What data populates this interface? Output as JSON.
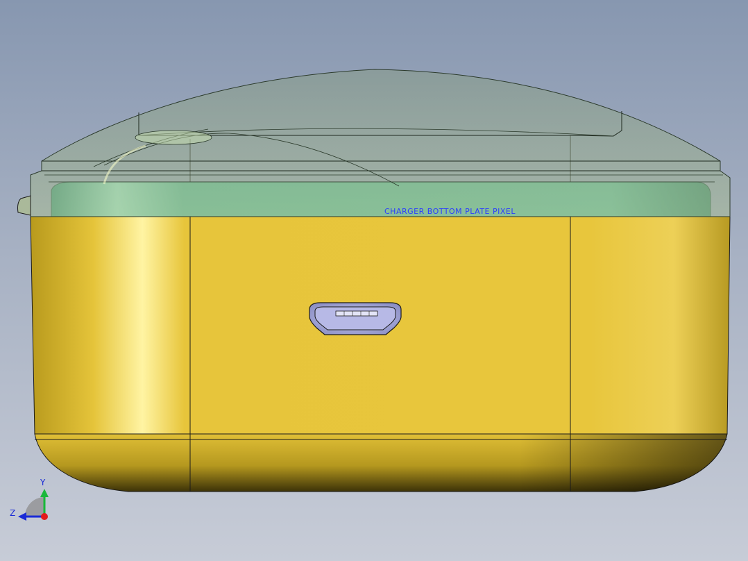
{
  "viewport": {
    "background_top": "#8797b0",
    "background_bottom": "#c7ccd7"
  },
  "model": {
    "body_color": "#e6c53b",
    "lid_color": "#9fb58f",
    "band_color": "#5fc09a",
    "port_color": "#a9abd6",
    "edge_color": "#1a1a1a",
    "overlapping_text": "CHARGER BOTTOM PLATE  PIXEL",
    "text_color": "#2a3cff"
  },
  "triad": {
    "y_label": "Y",
    "z_label": "Z",
    "y_color": "#19b83a",
    "z_color": "#1a2bd6",
    "x_color": "#e21b1b"
  }
}
